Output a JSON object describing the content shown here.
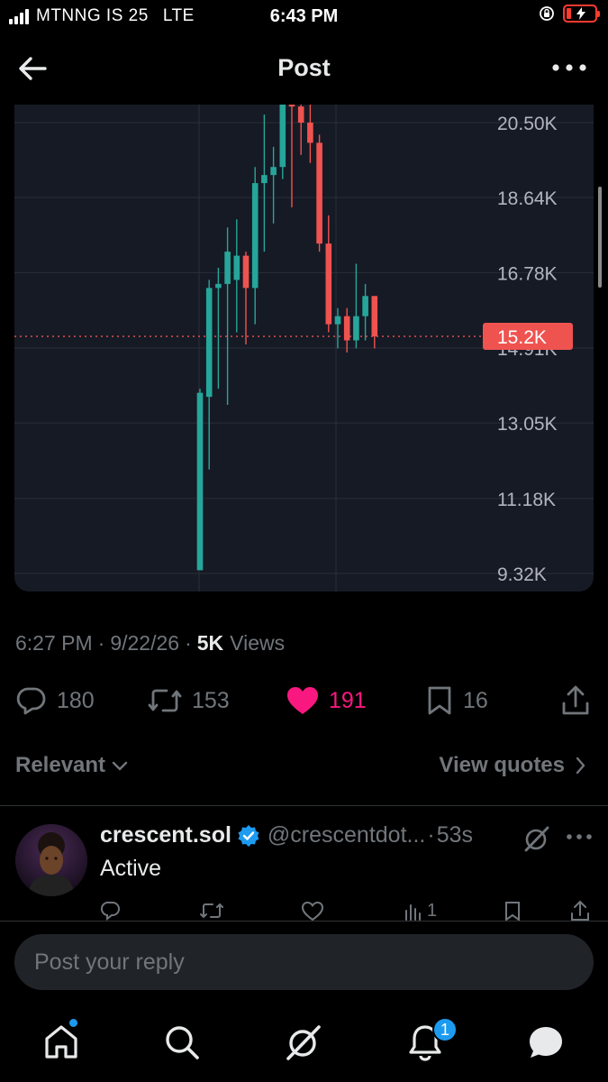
{
  "status_bar": {
    "carrier": "MTNNG IS 25",
    "network": "LTE",
    "time": "6:43 PM"
  },
  "header": {
    "title": "Post"
  },
  "chart_data": {
    "type": "candlestick",
    "y_ticks": [
      "20.50K",
      "18.64K",
      "16.78K",
      "14.91K",
      "13.05K",
      "11.18K",
      "9.32K"
    ],
    "y_tick_values": [
      20500,
      18640,
      16780,
      14910,
      13050,
      11180,
      9320
    ],
    "current_price_label": "15.2K",
    "current_price": 15200,
    "up_color": "#26a69a",
    "down_color": "#ef5350",
    "grid": true,
    "candles": [
      {
        "o": 9400,
        "h": 13900,
        "l": 9400,
        "c": 13800
      },
      {
        "o": 13700,
        "h": 16600,
        "l": 11900,
        "c": 16400
      },
      {
        "o": 16400,
        "h": 16900,
        "l": 13900,
        "c": 16500
      },
      {
        "o": 16500,
        "h": 17900,
        "l": 13500,
        "c": 17300
      },
      {
        "o": 16600,
        "h": 18100,
        "l": 15300,
        "c": 17200
      },
      {
        "o": 17200,
        "h": 17300,
        "l": 15000,
        "c": 16400
      },
      {
        "o": 16400,
        "h": 19400,
        "l": 15500,
        "c": 19000
      },
      {
        "o": 19000,
        "h": 20700,
        "l": 17300,
        "c": 19200
      },
      {
        "o": 19200,
        "h": 19900,
        "l": 18000,
        "c": 19400
      },
      {
        "o": 19400,
        "h": 21500,
        "l": 19100,
        "c": 21200
      },
      {
        "o": 21200,
        "h": 21200,
        "l": 18400,
        "c": 20900
      },
      {
        "o": 20900,
        "h": 21300,
        "l": 19700,
        "c": 20500
      },
      {
        "o": 20500,
        "h": 21000,
        "l": 19500,
        "c": 20000
      },
      {
        "o": 20000,
        "h": 20200,
        "l": 17300,
        "c": 17500
      },
      {
        "o": 17500,
        "h": 18200,
        "l": 15300,
        "c": 15500
      },
      {
        "o": 15500,
        "h": 15900,
        "l": 14900,
        "c": 15700
      },
      {
        "o": 15700,
        "h": 15900,
        "l": 14800,
        "c": 15100
      },
      {
        "o": 15100,
        "h": 17000,
        "l": 14900,
        "c": 15700
      },
      {
        "o": 15700,
        "h": 16500,
        "l": 15100,
        "c": 16200
      },
      {
        "o": 16200,
        "h": 16200,
        "l": 14900,
        "c": 15200
      }
    ]
  },
  "post_meta": {
    "time": "6:27 PM",
    "date": "9/22/26",
    "views_count": "5K",
    "views_label": "Views"
  },
  "actions": {
    "replies": "180",
    "reposts": "153",
    "likes": "191",
    "bookmarks": "16"
  },
  "replies_bar": {
    "sort_label": "Relevant",
    "view_quotes_label": "View quotes"
  },
  "reply": {
    "name": "crescent.sol",
    "handle": "@crescentdot...",
    "time": "53s",
    "text": "Active",
    "views": "1"
  },
  "reply_input": {
    "placeholder": "Post your reply"
  },
  "bottom_nav": {
    "notifications_badge": "1"
  },
  "colors": {
    "background": "#000000",
    "like": "#f91880",
    "accent": "#1d9bf0",
    "muted": "#71767b"
  }
}
